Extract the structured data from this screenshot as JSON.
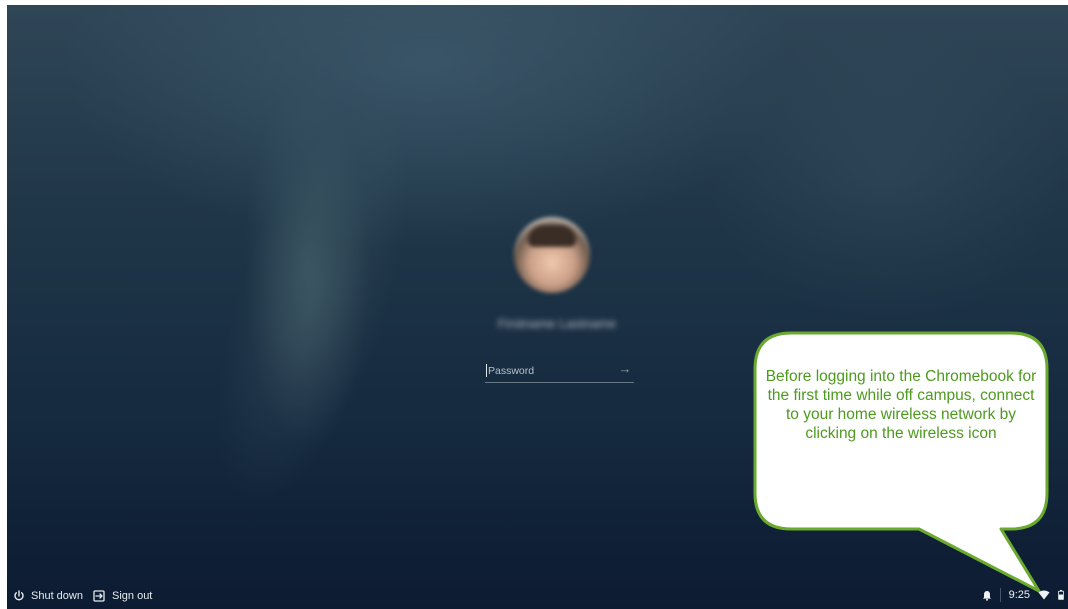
{
  "login": {
    "user_name": "Firstname Lastname",
    "password_placeholder": "Password",
    "submit_icon": "arrow-right-icon"
  },
  "callout": {
    "text": "Before logging into the Chromebook for the first time while off campus, connect to your home wireless network by clicking on the wireless icon",
    "border_color": "#6aaa2e",
    "text_color": "#4d9a1f"
  },
  "shelf": {
    "shutdown_label": "Shut down",
    "signout_label": "Sign out"
  },
  "tray": {
    "time": "9:25",
    "icons": [
      "notification-bell-icon",
      "wifi-icon",
      "battery-icon"
    ]
  },
  "colors": {
    "background_top": "#2f4657",
    "background_bottom": "#0c1b31"
  }
}
